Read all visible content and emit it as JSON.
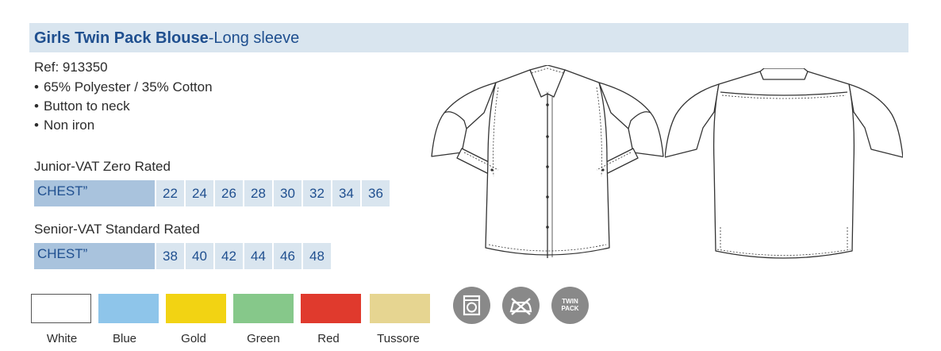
{
  "product": {
    "title_bold": "Girls Twin Pack Blouse",
    "title_rest": "-Long sleeve",
    "ref": "Ref: 913350",
    "features": [
      "65% Polyester  / 35% Cotton",
      "Button to neck",
      "Non iron"
    ]
  },
  "junior": {
    "label": "Junior-VAT Zero Rated",
    "head": "CHEST”",
    "sizes": [
      "22",
      "24",
      "26",
      "28",
      "30",
      "32",
      "34",
      "36"
    ]
  },
  "senior": {
    "label": "Senior-VAT Standard Rated",
    "head": "CHEST”",
    "sizes": [
      "38",
      "40",
      "42",
      "44",
      "46",
      "48"
    ]
  },
  "colours": [
    {
      "name": "White",
      "hex": "#ffffff"
    },
    {
      "name": "Blue",
      "hex": "#8ec5ea"
    },
    {
      "name": "Gold",
      "hex": "#f2d313"
    },
    {
      "name": "Green",
      "hex": "#86c88a"
    },
    {
      "name": "Red",
      "hex": "#e03a2d"
    },
    {
      "name": "Tussore",
      "hex": "#e6d591"
    }
  ],
  "care_icons": {
    "washing": "washing-machine-icon",
    "no_iron": "no-iron-icon",
    "twin_pack_line1": "TWIN",
    "twin_pack_line2": "PACK"
  }
}
